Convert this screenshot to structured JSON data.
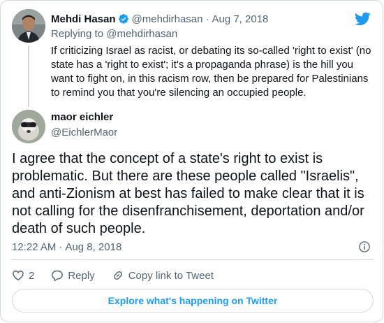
{
  "parent_tweet": {
    "name": "Mehdi Hasan",
    "handle": "@mehdirhasan",
    "separator": "·",
    "date": "Aug 7, 2018",
    "replying_label": "Replying to",
    "replying_handle": "@mehdirhasan",
    "text": "If criticizing Israel as racist, or debating its so-called 'right to exist' (no state has a 'right to exist'; it's a propaganda phrase) is the hill you want to fight on, in this racism row, then be prepared for Palestinians to remind you that you're silencing an occupied people."
  },
  "reply_tweet": {
    "name": "maor eichler",
    "handle": "@EichlerMaor",
    "text": "I agree that the concept of a state's right to exist is problematic. But there are these people called \"Israelis\", and anti-Zionism at best has failed to make clear that it is not calling for the disenfranchisement, deportation and/or death of such people.",
    "time": "12:22 AM",
    "separator": "·",
    "date": "Aug 8, 2018"
  },
  "actions": {
    "like_count": "2",
    "reply_label": "Reply",
    "copy_link_label": "Copy link to Tweet"
  },
  "explore_label": "Explore what's happening on Twitter",
  "colors": {
    "accent": "#1d9bf0",
    "secondary_text": "#536471",
    "border": "#cfd9de"
  },
  "icons": [
    "verified-badge-icon",
    "twitter-bird-icon",
    "info-icon",
    "heart-icon",
    "reply-bubble-icon",
    "link-icon"
  ]
}
